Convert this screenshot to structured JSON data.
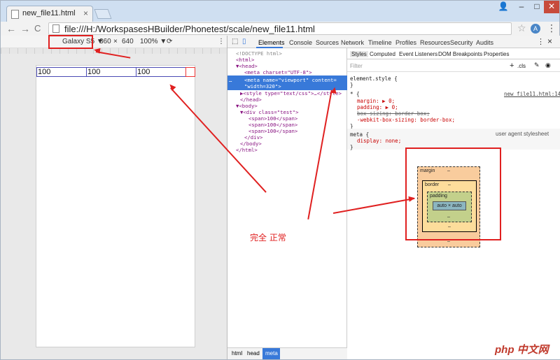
{
  "browser": {
    "tab_title": "new_file11.html",
    "tab_close": "×",
    "window_buttons": {
      "user": "👤",
      "minimize": "–",
      "maximize": "□",
      "close": "✕"
    },
    "back": "←",
    "forward": "→",
    "reload": "C",
    "address": "file:///H:/WorkspasesHBuilder/Phonetest/scale/new_file11.html",
    "star": "☆",
    "extension": "A",
    "menu": "⋮"
  },
  "emulation": {
    "device": "Galaxy S5 ▼",
    "width": "360",
    "times": "×",
    "height": "640",
    "zoom": "100% ▼",
    "rotate": "⟳",
    "more": "⋮"
  },
  "page": {
    "spans": [
      "100",
      "100",
      "100"
    ]
  },
  "devtools": {
    "tabs": [
      "Elements",
      "Console",
      "Sources",
      "Network",
      "Timeline",
      "Profiles",
      "Resources",
      "Security",
      "Audits"
    ],
    "more": "⋮",
    "close": "×",
    "dom_lines": [
      "<!DOCTYPE html>",
      "<html>",
      "▼<head>",
      "<meta charset=\"UTF-8\">",
      "<meta name=\"viewport\" content=",
      "\"width=320\">",
      "▶<style type=\"text/css\">…</style>",
      "</head>",
      "▼<body>",
      "▼<div class=\"test\">",
      "<span>100</span>",
      "<span>100</span>",
      "<span>100</span>",
      "</div>",
      "</body>",
      "</html>"
    ],
    "ellipsis": "…",
    "breadcrumbs": [
      "html",
      "head",
      "meta"
    ],
    "styles_tabs": [
      "Styles",
      "Computed",
      "Event Listeners",
      "DOM Breakpoints",
      "Properties"
    ],
    "filter_placeholder": "Filter",
    "filter_tools": ".cls",
    "rules": {
      "element_style": "element.style {",
      "close": "}",
      "star_selector": "* {",
      "source": "new_file11.html:14",
      "margin": "margin: ▶ 0;",
      "padding": "padding: ▶ 0;",
      "box_sizing": "box-sizing: border-box;",
      "webkit_box_sizing": "-webkit-box-sizing: border-box;",
      "meta_selector": "meta {",
      "ua_label": "user agent stylesheet",
      "display": "display: none;"
    },
    "box_model": {
      "margin_label": "margin",
      "border_label": "border",
      "padding_label": "padding",
      "content": "auto × auto",
      "dash": "–"
    }
  },
  "annotation": {
    "note": "完全  正常"
  },
  "watermark": "php 中文网"
}
